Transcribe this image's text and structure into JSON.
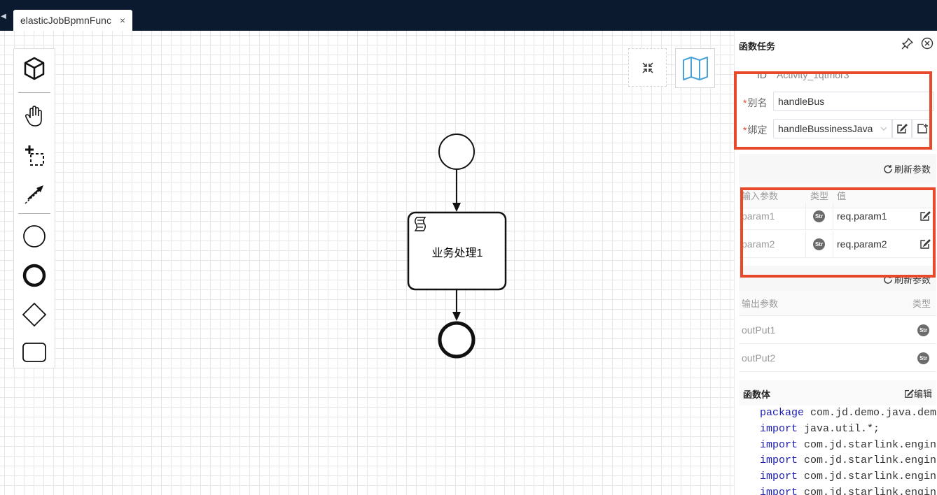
{
  "tab": {
    "label": "elasticJobBpmnFunc",
    "close": "×",
    "prev": "◀"
  },
  "diagram": {
    "task_label": "业务处理1"
  },
  "palette": {
    "items": [
      "create-icon",
      "hand-tool-icon",
      "lasso-tool-icon",
      "connect-tool-icon",
      "start-event-icon",
      "end-event-icon",
      "gateway-icon",
      "task-icon"
    ]
  },
  "panel": {
    "title": "函数任务",
    "id_label": "ID",
    "id_value": "Activity_1qtmor3",
    "alias_label": "别名",
    "alias_value": "handleBus",
    "bind_label": "绑定",
    "bind_value": "handleBussinessJava",
    "required_mark": "*",
    "refresh_label": "刷新参数",
    "input_table": {
      "headers": [
        "输入参数",
        "类型",
        "值"
      ],
      "rows": [
        {
          "name": "param1",
          "type": "Str",
          "value": "req.param1"
        },
        {
          "name": "param2",
          "type": "Str",
          "value": "req.param2"
        }
      ]
    },
    "output_table": {
      "headers": [
        "输出参数",
        "类型"
      ],
      "rows": [
        {
          "name": "outPut1",
          "type": "Str"
        },
        {
          "name": "outPut2",
          "type": "Str"
        }
      ]
    },
    "func_title": "函数体",
    "func_edit": "编辑",
    "code_lines": [
      {
        "kw": "package",
        "rest": " com.jd.demo.java.demo"
      },
      {
        "kw": "import",
        "rest": " java.util.*;"
      },
      {
        "kw": "import",
        "rest": " com.jd.starlink.engine"
      },
      {
        "kw": "import",
        "rest": " com.jd.starlink.engine"
      },
      {
        "kw": "import",
        "rest": " com.jd.starlink.engine"
      },
      {
        "kw": "import",
        "rest": " com.jd.starlink.engine"
      }
    ]
  },
  "colors": {
    "topbar": "#0b1a2e",
    "highlight": "#e8492b",
    "keyword": "#1b1bb5"
  }
}
